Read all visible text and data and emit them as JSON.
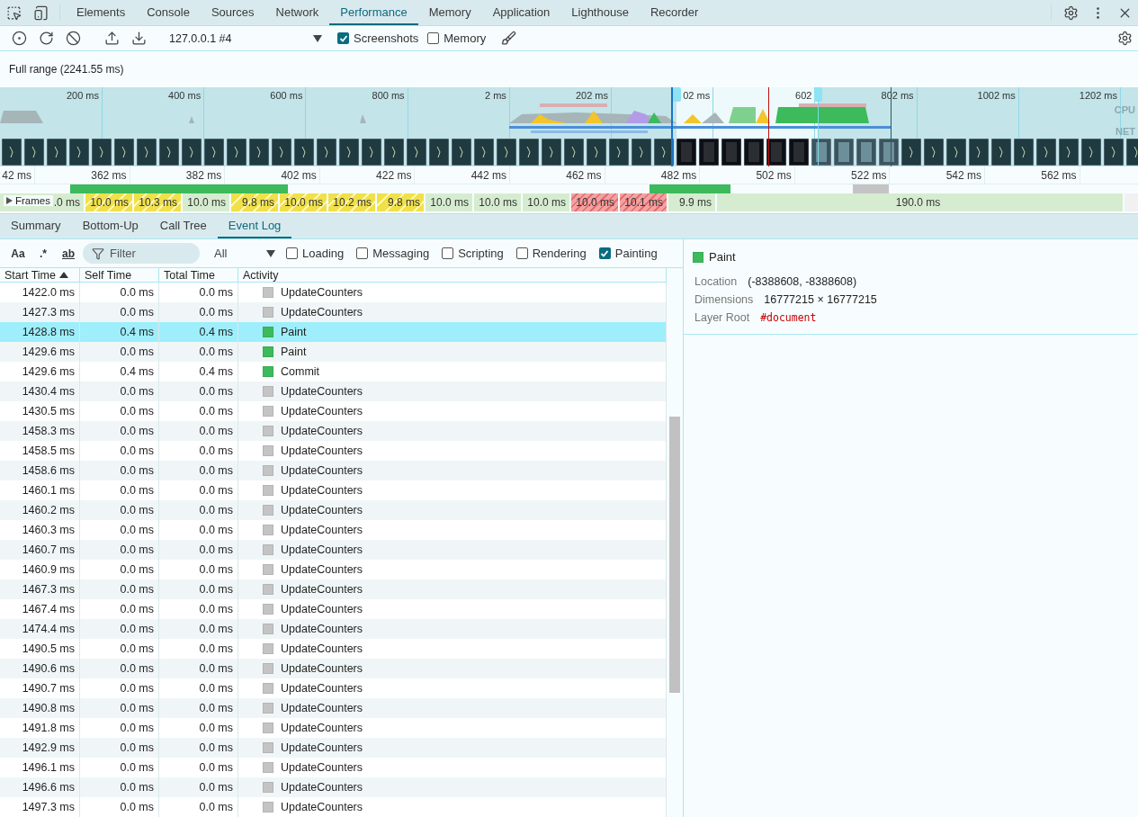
{
  "tabs": [
    {
      "label": "Elements",
      "selected": false
    },
    {
      "label": "Console",
      "selected": false
    },
    {
      "label": "Sources",
      "selected": false
    },
    {
      "label": "Network",
      "selected": false
    },
    {
      "label": "Performance",
      "selected": true
    },
    {
      "label": "Memory",
      "selected": false
    },
    {
      "label": "Application",
      "selected": false
    },
    {
      "label": "Lighthouse",
      "selected": false
    },
    {
      "label": "Recorder",
      "selected": false
    }
  ],
  "toolbar": {
    "target": "127.0.0.1 #4",
    "options": [
      {
        "label": "Screenshots",
        "checked": true
      },
      {
        "label": "Memory",
        "checked": false
      }
    ]
  },
  "range_label": "Full range (2241.55 ms)",
  "overview": {
    "ticks": [
      "200 ms",
      "400 ms",
      "600 ms",
      "800 ms",
      "2 ms",
      "202 ms",
      "02 ms",
      "602",
      "802 ms",
      "1002 ms",
      "1202 ms"
    ],
    "track_labels": [
      "CPU",
      "NET"
    ]
  },
  "timeline": {
    "ticks": [
      "42 ms",
      "362 ms",
      "382 ms",
      "402 ms",
      "422 ms",
      "442 ms",
      "462 ms",
      "482 ms",
      "502 ms",
      "522 ms",
      "542 ms",
      "562 ms"
    ],
    "frames_label": "Frames",
    "frames": [
      {
        "duration": ".0 ms",
        "kind": "idle"
      },
      {
        "duration": "10.0 ms",
        "kind": "partial"
      },
      {
        "duration": "10.3 ms",
        "kind": "partial"
      },
      {
        "duration": "10.0 ms",
        "kind": "idle"
      },
      {
        "duration": "9.8 ms",
        "kind": "partial"
      },
      {
        "duration": "10.0 ms",
        "kind": "partial"
      },
      {
        "duration": "10.2 ms",
        "kind": "partial"
      },
      {
        "duration": "9.8 ms",
        "kind": "partial"
      },
      {
        "duration": "10.0 ms",
        "kind": "idle"
      },
      {
        "duration": "10.0 ms",
        "kind": "idle"
      },
      {
        "duration": "10.0 ms",
        "kind": "idle"
      },
      {
        "duration": "10.0 ms",
        "kind": "dropped"
      },
      {
        "duration": "10.1 ms",
        "kind": "dropped"
      },
      {
        "duration": "9.9 ms",
        "kind": "idle"
      },
      {
        "duration": "190.0 ms",
        "kind": "long"
      }
    ]
  },
  "details_tabs": [
    {
      "label": "Summary",
      "selected": false
    },
    {
      "label": "Bottom-Up",
      "selected": false
    },
    {
      "label": "Call Tree",
      "selected": false
    },
    {
      "label": "Event Log",
      "selected": true
    }
  ],
  "filter": {
    "match_case": "Aa",
    "regex": ".*",
    "whole_word": "ab",
    "placeholder": "Filter",
    "duration": "All",
    "categories": [
      {
        "label": "Loading",
        "checked": false
      },
      {
        "label": "Messaging",
        "checked": false
      },
      {
        "label": "Scripting",
        "checked": false
      },
      {
        "label": "Rendering",
        "checked": false
      },
      {
        "label": "Painting",
        "checked": true
      }
    ]
  },
  "table": {
    "columns": [
      {
        "label": "Start Time",
        "sorted": true
      },
      {
        "label": "Self Time",
        "sorted": false
      },
      {
        "label": "Total Time",
        "sorted": false
      },
      {
        "label": "Activity",
        "sorted": false
      }
    ],
    "rows": [
      {
        "start": "1422.0 ms",
        "self": "0.0 ms",
        "total": "0.0 ms",
        "activity": "UpdateCounters",
        "color": "#c4c4c4",
        "selected": false
      },
      {
        "start": "1427.3 ms",
        "self": "0.0 ms",
        "total": "0.0 ms",
        "activity": "UpdateCounters",
        "color": "#c4c4c4",
        "selected": false
      },
      {
        "start": "1428.8 ms",
        "self": "0.4 ms",
        "total": "0.4 ms",
        "activity": "Paint",
        "color": "#3cba5c",
        "selected": true
      },
      {
        "start": "1429.6 ms",
        "self": "0.0 ms",
        "total": "0.0 ms",
        "activity": "Paint",
        "color": "#3cba5c",
        "selected": false
      },
      {
        "start": "1429.6 ms",
        "self": "0.4 ms",
        "total": "0.4 ms",
        "activity": "Commit",
        "color": "#3cba5c",
        "selected": false
      },
      {
        "start": "1430.4 ms",
        "self": "0.0 ms",
        "total": "0.0 ms",
        "activity": "UpdateCounters",
        "color": "#c4c4c4",
        "selected": false
      },
      {
        "start": "1430.5 ms",
        "self": "0.0 ms",
        "total": "0.0 ms",
        "activity": "UpdateCounters",
        "color": "#c4c4c4",
        "selected": false
      },
      {
        "start": "1458.3 ms",
        "self": "0.0 ms",
        "total": "0.0 ms",
        "activity": "UpdateCounters",
        "color": "#c4c4c4",
        "selected": false
      },
      {
        "start": "1458.5 ms",
        "self": "0.0 ms",
        "total": "0.0 ms",
        "activity": "UpdateCounters",
        "color": "#c4c4c4",
        "selected": false
      },
      {
        "start": "1458.6 ms",
        "self": "0.0 ms",
        "total": "0.0 ms",
        "activity": "UpdateCounters",
        "color": "#c4c4c4",
        "selected": false
      },
      {
        "start": "1460.1 ms",
        "self": "0.0 ms",
        "total": "0.0 ms",
        "activity": "UpdateCounters",
        "color": "#c4c4c4",
        "selected": false
      },
      {
        "start": "1460.2 ms",
        "self": "0.0 ms",
        "total": "0.0 ms",
        "activity": "UpdateCounters",
        "color": "#c4c4c4",
        "selected": false
      },
      {
        "start": "1460.3 ms",
        "self": "0.0 ms",
        "total": "0.0 ms",
        "activity": "UpdateCounters",
        "color": "#c4c4c4",
        "selected": false
      },
      {
        "start": "1460.7 ms",
        "self": "0.0 ms",
        "total": "0.0 ms",
        "activity": "UpdateCounters",
        "color": "#c4c4c4",
        "selected": false
      },
      {
        "start": "1460.9 ms",
        "self": "0.0 ms",
        "total": "0.0 ms",
        "activity": "UpdateCounters",
        "color": "#c4c4c4",
        "selected": false
      },
      {
        "start": "1467.3 ms",
        "self": "0.0 ms",
        "total": "0.0 ms",
        "activity": "UpdateCounters",
        "color": "#c4c4c4",
        "selected": false
      },
      {
        "start": "1467.4 ms",
        "self": "0.0 ms",
        "total": "0.0 ms",
        "activity": "UpdateCounters",
        "color": "#c4c4c4",
        "selected": false
      },
      {
        "start": "1474.4 ms",
        "self": "0.0 ms",
        "total": "0.0 ms",
        "activity": "UpdateCounters",
        "color": "#c4c4c4",
        "selected": false
      },
      {
        "start": "1490.5 ms",
        "self": "0.0 ms",
        "total": "0.0 ms",
        "activity": "UpdateCounters",
        "color": "#c4c4c4",
        "selected": false
      },
      {
        "start": "1490.6 ms",
        "self": "0.0 ms",
        "total": "0.0 ms",
        "activity": "UpdateCounters",
        "color": "#c4c4c4",
        "selected": false
      },
      {
        "start": "1490.7 ms",
        "self": "0.0 ms",
        "total": "0.0 ms",
        "activity": "UpdateCounters",
        "color": "#c4c4c4",
        "selected": false
      },
      {
        "start": "1490.8 ms",
        "self": "0.0 ms",
        "total": "0.0 ms",
        "activity": "UpdateCounters",
        "color": "#c4c4c4",
        "selected": false
      },
      {
        "start": "1491.8 ms",
        "self": "0.0 ms",
        "total": "0.0 ms",
        "activity": "UpdateCounters",
        "color": "#c4c4c4",
        "selected": false
      },
      {
        "start": "1492.9 ms",
        "self": "0.0 ms",
        "total": "0.0 ms",
        "activity": "UpdateCounters",
        "color": "#c4c4c4",
        "selected": false
      },
      {
        "start": "1496.1 ms",
        "self": "0.0 ms",
        "total": "0.0 ms",
        "activity": "UpdateCounters",
        "color": "#c4c4c4",
        "selected": false
      },
      {
        "start": "1496.6 ms",
        "self": "0.0 ms",
        "total": "0.0 ms",
        "activity": "UpdateCounters",
        "color": "#c4c4c4",
        "selected": false
      },
      {
        "start": "1497.3 ms",
        "self": "0.0 ms",
        "total": "0.0 ms",
        "activity": "UpdateCounters",
        "color": "#c4c4c4",
        "selected": false
      }
    ]
  },
  "detail": {
    "title": "Paint",
    "color": "#3cba5c",
    "fields": [
      {
        "label": "Location",
        "value": "(-8388608, -8388608)",
        "kind": "text"
      },
      {
        "label": "Dimensions",
        "value": "16777215 × 16777215",
        "kind": "text"
      },
      {
        "label": "Layer Root",
        "value": "#document",
        "kind": "node"
      }
    ]
  }
}
